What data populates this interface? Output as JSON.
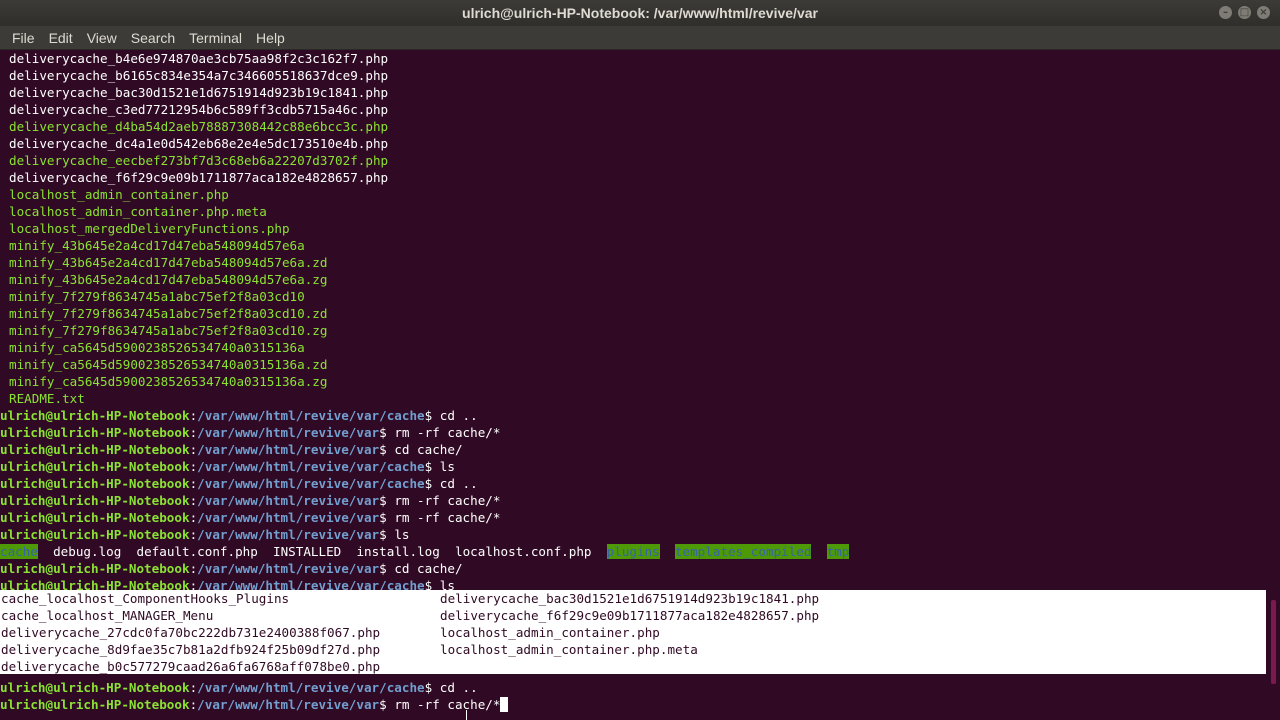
{
  "window": {
    "title": "ulrich@ulrich-HP-Notebook: /var/www/html/revive/var",
    "buttons": [
      "–",
      "□",
      "×"
    ]
  },
  "menu": [
    "File",
    "Edit",
    "View",
    "Search",
    "Terminal",
    "Help"
  ],
  "prompt": {
    "user": "ulrich@ulrich-HP-Notebook",
    "path_var": "/var/www/html/revive/var",
    "path_cache": "/var/www/html/revive/var/cache"
  },
  "listing": [
    {
      "text": "deliverycache_b4e6e974870ae3cb75aa98f2c3c162f7.php",
      "green": false
    },
    {
      "text": "deliverycache_b6165c834e354a7c346605518637dce9.php",
      "green": false
    },
    {
      "text": "deliverycache_bac30d1521e1d6751914d923b19c1841.php",
      "green": false
    },
    {
      "text": "deliverycache_c3ed77212954b6c589ff3cdb5715a46c.php",
      "green": false
    },
    {
      "text": "deliverycache_d4ba54d2aeb78887308442c88e6bcc3c.php",
      "green": true
    },
    {
      "text": "deliverycache_dc4a1e0d542eb68e2e4e5dc173510e4b.php",
      "green": false
    },
    {
      "text": "deliverycache_eecbef273bf7d3c68eb6a22207d3702f.php",
      "green": true
    },
    {
      "text": "deliverycache_f6f29c9e09b1711877aca182e4828657.php",
      "green": false
    },
    {
      "text": "localhost_admin_container.php",
      "green": true
    },
    {
      "text": "localhost_admin_container.php.meta",
      "green": true
    },
    {
      "text": "localhost_mergedDeliveryFunctions.php",
      "green": true
    },
    {
      "text": "minify_43b645e2a4cd17d47eba548094d57e6a",
      "green": true
    },
    {
      "text": "minify_43b645e2a4cd17d47eba548094d57e6a.zd",
      "green": true
    },
    {
      "text": "minify_43b645e2a4cd17d47eba548094d57e6a.zg",
      "green": true
    },
    {
      "text": "minify_7f279f8634745a1abc75ef2f8a03cd10",
      "green": true
    },
    {
      "text": "minify_7f279f8634745a1abc75ef2f8a03cd10.zd",
      "green": true
    },
    {
      "text": "minify_7f279f8634745a1abc75ef2f8a03cd10.zg",
      "green": true
    },
    {
      "text": "minify_ca5645d5900238526534740a0315136a",
      "green": true
    },
    {
      "text": "minify_ca5645d5900238526534740a0315136a.zd",
      "green": true
    },
    {
      "text": "minify_ca5645d5900238526534740a0315136a.zg",
      "green": true
    },
    {
      "text": "README.txt",
      "green": true
    }
  ],
  "history": [
    {
      "dir": "cache",
      "cmd": "cd .."
    },
    {
      "dir": "var",
      "cmd": "rm -rf cache/*"
    },
    {
      "dir": "var",
      "cmd": "cd cache/"
    },
    {
      "dir": "cache",
      "cmd": "ls"
    },
    {
      "dir": "cache",
      "cmd": "cd .."
    },
    {
      "dir": "var",
      "cmd": "rm -rf cache/*"
    },
    {
      "dir": "var",
      "cmd": "rm -rf cache/*"
    },
    {
      "dir": "var",
      "cmd": "ls"
    }
  ],
  "ls_var": [
    {
      "text": "cache",
      "dir": true
    },
    {
      "text": "debug.log",
      "dir": false
    },
    {
      "text": "default.conf.php",
      "dir": false
    },
    {
      "text": "INSTALLED",
      "dir": false
    },
    {
      "text": "install.log",
      "dir": false
    },
    {
      "text": "localhost.conf.php",
      "dir": false
    },
    {
      "text": "plugins",
      "dir": true
    },
    {
      "text": "templates_compiled",
      "dir": true
    },
    {
      "text": "tmp",
      "dir": true
    }
  ],
  "history2": [
    {
      "dir": "var",
      "cmd": "cd cache/"
    },
    {
      "dir": "cache",
      "cmd": "ls"
    }
  ],
  "popup": {
    "col1": [
      "cache_localhost_ComponentHooks_Plugins",
      "cache_localhost_MANAGER_Menu",
      "deliverycache_27cdc0fa70bc222db731e2400388f067.php",
      "deliverycache_8d9fae35c7b81a2dfb924f25b09df27d.php",
      "deliverycache_b0c577279caad26a6fa6768aff078be0.php"
    ],
    "col2": [
      "deliverycache_bac30d1521e1d6751914d923b19c1841.php",
      "deliverycache_f6f29c9e09b1711877aca182e4828657.php",
      "localhost_admin_container.php",
      "localhost_admin_container.php.meta"
    ]
  },
  "history3": [
    {
      "dir": "cache",
      "cmd": "cd .."
    },
    {
      "dir": "var",
      "cmd": "rm -rf cache/*"
    }
  ]
}
